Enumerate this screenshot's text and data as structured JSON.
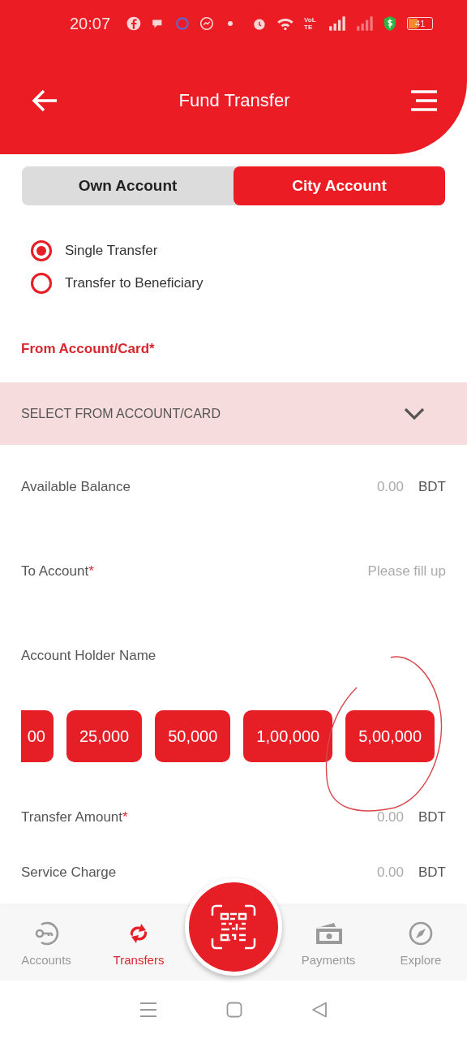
{
  "status_bar": {
    "time": "20:07",
    "network_label": "VoLTE",
    "battery": "41"
  },
  "header": {
    "title": "Fund Transfer"
  },
  "tabs": [
    {
      "label": "Own Account",
      "selected": false
    },
    {
      "label": "City Account",
      "selected": true
    }
  ],
  "transfer_types": [
    {
      "label": "Single Transfer",
      "selected": true
    },
    {
      "label": "Transfer to Beneficiary",
      "selected": false
    }
  ],
  "from_account": {
    "label": "From Account/Card",
    "required_mark": "*",
    "placeholder": "SELECT FROM ACCOUNT/CARD"
  },
  "fields": [
    {
      "kind": "value",
      "label": "Available Balance",
      "value": "0.00",
      "unit": "BDT"
    },
    {
      "kind": "input",
      "label": "To Account",
      "required_mark": "*",
      "placeholder": "Please fill up"
    },
    {
      "kind": "label",
      "label": "Account Holder Name"
    }
  ],
  "amount_chips": [
    "00",
    "25,000",
    "50,000",
    "1,00,000",
    "5,00,000"
  ],
  "amount_fields": [
    {
      "kind": "value",
      "label": "Transfer Amount",
      "required_mark": "*",
      "value": "0.00",
      "unit": "BDT"
    },
    {
      "kind": "value",
      "label": "Service Charge",
      "value": "0.00",
      "unit": "BDT"
    }
  ],
  "bottom_nav": [
    {
      "kind": "accounts",
      "label": "Accounts",
      "selected": false
    },
    {
      "kind": "transfers",
      "label": "Transfers",
      "selected": true
    },
    {
      "kind": "scan"
    },
    {
      "kind": "payments",
      "label": "Payments",
      "selected": false
    },
    {
      "kind": "explore",
      "label": "Explore",
      "selected": false
    }
  ]
}
